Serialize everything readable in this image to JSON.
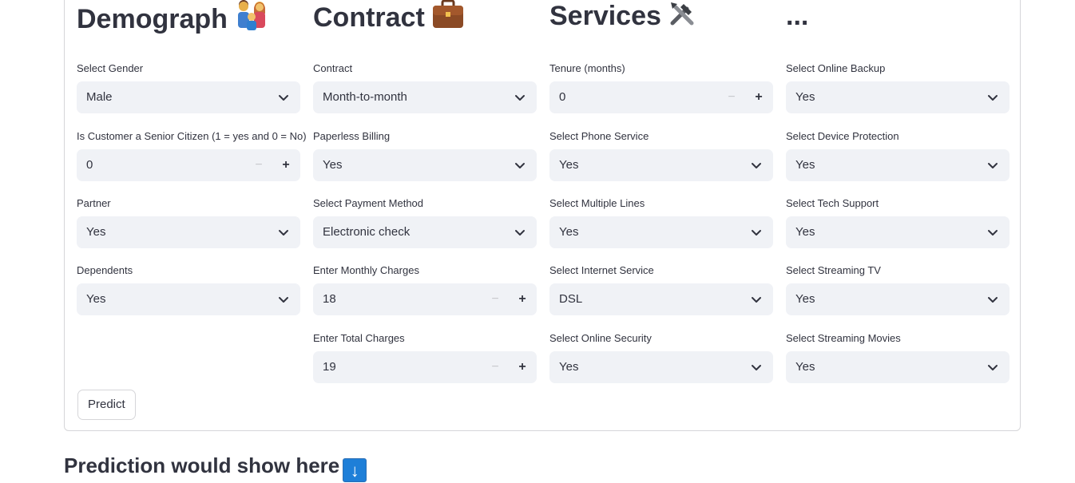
{
  "columns": [
    {
      "title": "Demograph",
      "icon": "family-icon",
      "fields": [
        {
          "label": "Select Gender",
          "type": "select",
          "value": "Male"
        },
        {
          "label": "Is Customer a Senior Citizen (1 = yes and 0 = No)",
          "type": "number",
          "value": "0"
        },
        {
          "label": "Partner",
          "type": "select",
          "value": "Yes"
        },
        {
          "label": "Dependents",
          "type": "select",
          "value": "Yes"
        }
      ]
    },
    {
      "title": "Contract",
      "icon": "briefcase-icon",
      "fields": [
        {
          "label": "Contract",
          "type": "select",
          "value": "Month-to-month"
        },
        {
          "label": "Paperless Billing",
          "type": "select",
          "value": "Yes"
        },
        {
          "label": "Select Payment Method",
          "type": "select",
          "value": "Electronic check"
        },
        {
          "label": "Enter Monthly Charges",
          "type": "number",
          "value": "18"
        },
        {
          "label": "Enter Total Charges",
          "type": "number",
          "value": "19"
        }
      ]
    },
    {
      "title": "Services",
      "icon": "tools-icon",
      "fields": [
        {
          "label": "Tenure (months)",
          "type": "number",
          "value": "0"
        },
        {
          "label": "Select Phone Service",
          "type": "select",
          "value": "Yes"
        },
        {
          "label": "Select Multiple Lines",
          "type": "select",
          "value": "Yes"
        },
        {
          "label": "Select Internet Service",
          "type": "select",
          "value": "DSL"
        },
        {
          "label": "Select Online Security",
          "type": "select",
          "value": "Yes"
        }
      ]
    },
    {
      "title": "...",
      "icon": "",
      "fields": [
        {
          "label": "Select Online Backup",
          "type": "select",
          "value": "Yes"
        },
        {
          "label": "Select Device Protection",
          "type": "select",
          "value": "Yes"
        },
        {
          "label": "Select Tech Support",
          "type": "select",
          "value": "Yes"
        },
        {
          "label": "Select Streaming TV",
          "type": "select",
          "value": "Yes"
        },
        {
          "label": "Select Streaming Movies",
          "type": "select",
          "value": "Yes"
        }
      ]
    }
  ],
  "predict_button": {
    "label": "Predict"
  },
  "result": {
    "heading": "Prediction would show here",
    "icon": "arrow-down-icon"
  },
  "colors": {
    "input_bg": "#f0f2f6",
    "text": "#31333f",
    "border": "#d6d6d9",
    "arrow_bg": "#1e7fd8"
  }
}
